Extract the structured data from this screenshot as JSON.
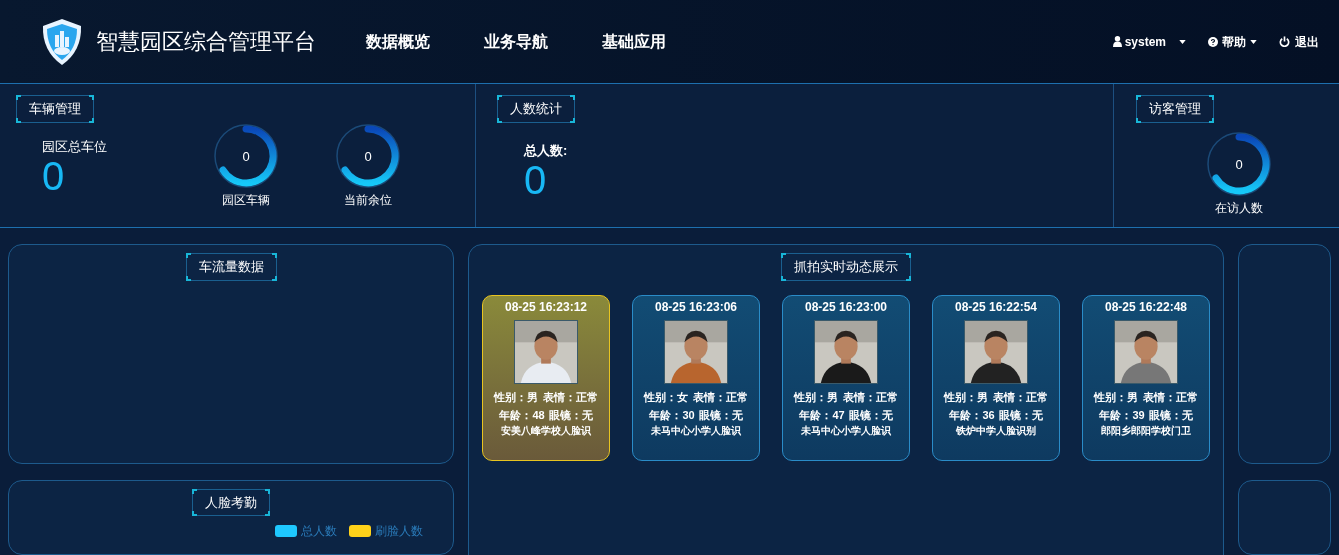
{
  "header": {
    "title": "智慧园区综合管理平台",
    "nav": [
      {
        "label": "数据概览"
      },
      {
        "label": "业务导航"
      },
      {
        "label": "基础应用"
      }
    ],
    "user": "system",
    "help": "帮助",
    "logout": "退出"
  },
  "vehicle": {
    "title": "车辆管理",
    "total_label": "园区总车位",
    "total": "0",
    "gauges": [
      {
        "value": "0",
        "label": "园区车辆"
      },
      {
        "value": "0",
        "label": "当前余位"
      }
    ]
  },
  "people": {
    "title": "人数统计",
    "total_label": "总人数:",
    "total": "0"
  },
  "visitor": {
    "title": "访客管理",
    "gauges": [
      {
        "value": "0",
        "label": "在访人数"
      }
    ]
  },
  "traffic": {
    "title": "车流量数据"
  },
  "capture": {
    "title": "抓拍实时动态展示",
    "cards": [
      {
        "time": "08-25 16:23:12",
        "gender": "性别：男",
        "mood": "表情：正常",
        "age": "年龄：48",
        "glasses": "眼镜：无",
        "place": "安美八峰学校人脸识",
        "selected": true
      },
      {
        "time": "08-25 16:23:06",
        "gender": "性别：女",
        "mood": "表情：正常",
        "age": "年龄：30",
        "glasses": "眼镜：无",
        "place": "未马中心小学人脸识",
        "selected": false
      },
      {
        "time": "08-25 16:23:00",
        "gender": "性别：男",
        "mood": "表情：正常",
        "age": "年龄：47",
        "glasses": "眼镜：无",
        "place": "未马中心小学人脸识",
        "selected": false
      },
      {
        "time": "08-25 16:22:54",
        "gender": "性别：男",
        "mood": "表情：正常",
        "age": "年龄：36",
        "glasses": "眼镜：无",
        "place": "铁炉中学人脸识别",
        "selected": false
      },
      {
        "time": "08-25 16:22:48",
        "gender": "性别：男",
        "mood": "表情：正常",
        "age": "年龄：39",
        "glasses": "眼镜：无",
        "place": "郎阳乡郎阳学校门卫",
        "selected": false
      }
    ]
  },
  "attendance": {
    "title": "人脸考勤",
    "legend": [
      {
        "label": "总人数",
        "color": "#1ec8ff"
      },
      {
        "label": "刷脸人数",
        "color": "#ffd21a"
      }
    ]
  }
}
